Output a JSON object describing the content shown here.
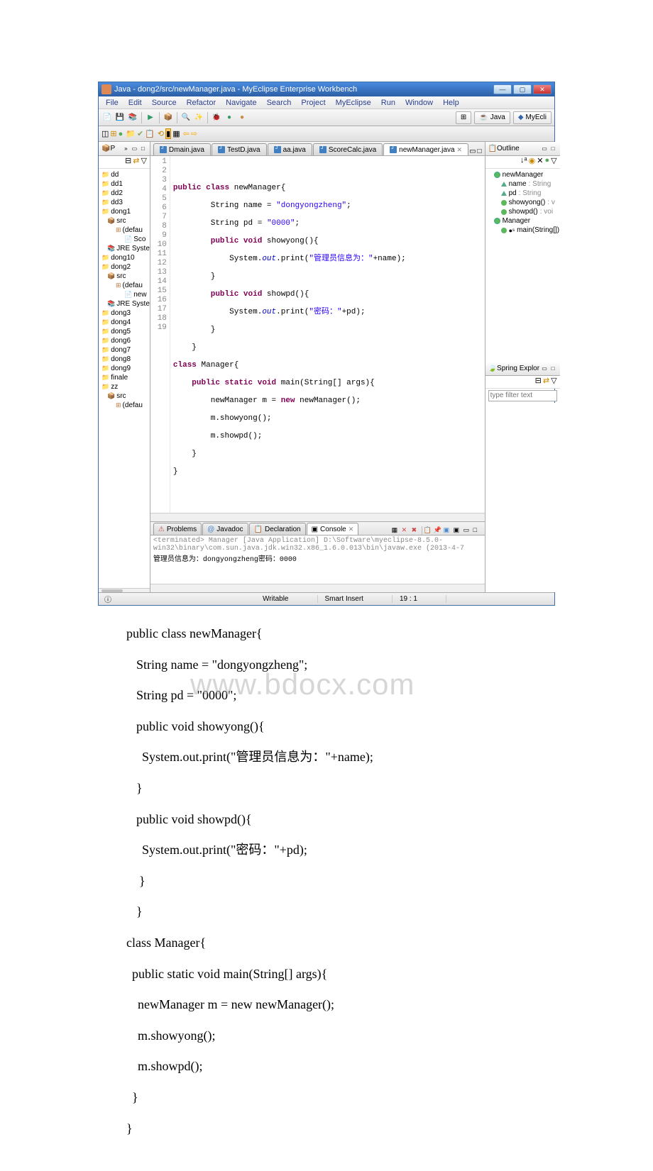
{
  "window": {
    "title": "Java - dong2/src/newManager.java - MyEclipse Enterprise Workbench",
    "min": "—",
    "max": "▢",
    "close": "✕"
  },
  "menu": {
    "items": [
      "File",
      "Edit",
      "Source",
      "Refactor",
      "Navigate",
      "Search",
      "Project",
      "MyEclipse",
      "Run",
      "Window",
      "Help"
    ]
  },
  "perspectives": {
    "java": "Java",
    "myecli": "MyEcli"
  },
  "package_explorer": {
    "tab": "P",
    "projects": [
      "dd",
      "dd1",
      "dd2",
      "dd3",
      "dong1",
      "dong10",
      "dong2",
      "dong3",
      "dong4",
      "dong5",
      "dong6",
      "dong7",
      "dong8",
      "dong9",
      "finale",
      "zz"
    ],
    "dong1_children": {
      "src": "src",
      "defau": "(defau",
      "sco": "Sco",
      "jre": "JRE Syste"
    },
    "dong2_children": {
      "src": "src",
      "defau": "(defau",
      "new": "new",
      "jre": "JRE Syste"
    },
    "zz_children": {
      "src": "src",
      "defau": "(defau"
    }
  },
  "editor": {
    "tabs": [
      "Dmain.java",
      "TestD.java",
      "aa.java",
      "ScoreCalc.java",
      "newManager.java"
    ],
    "active_tab": "newManager.java",
    "lines": {
      "l1": "",
      "l2a": "public class",
      "l2b": " newManager{",
      "l3a": "        String name = ",
      "l3b": "\"dongyongzheng\"",
      "l3c": ";",
      "l4a": "        String pd = ",
      "l4b": "\"0000\"",
      "l4c": ";",
      "l5a": "        public void",
      "l5b": " showyong(){",
      "l6a": "            System.",
      "l6b": "out",
      "l6c": ".print(",
      "l6d": "\"管理员信息为：\"",
      "l6e": "+name);",
      "l7": "        }",
      "l8a": "        public void",
      "l8b": " showpd(){",
      "l9a": "            System.",
      "l9b": "out",
      "l9c": ".print(",
      "l9d": "\"密码：\"",
      "l9e": "+pd);",
      "l10": "        }",
      "l11": "    }",
      "l12a": "class",
      "l12b": " Manager{",
      "l13a": "    public static void",
      "l13b": " main(String[] args){",
      "l14a": "        newManager m = ",
      "l14b": "new",
      "l14c": " newManager();",
      "l15": "        m.showyong();",
      "l16": "        m.showpd();",
      "l17": "    }",
      "l18": "}",
      "l19": ""
    }
  },
  "bottom": {
    "tabs": {
      "problems": "Problems",
      "javadoc": "Javadoc",
      "declaration": "Declaration",
      "console": "Console"
    },
    "terminated": "<terminated> Manager [Java Application] D:\\Software\\myeclipse-8.5.0-win32\\binary\\com.sun.java.jdk.win32.x86_1.6.0.013\\bin\\javaw.exe (2013-4-7",
    "output": "管理员信息为：dongyongzheng密码：0000"
  },
  "outline": {
    "tab": "Outline",
    "items": {
      "newManager": "newManager",
      "name": "name",
      "name_t": ": String",
      "pd": "pd",
      "pd_t": ": String",
      "showyong": "showyong()",
      "showyong_t": ": v",
      "showpd": "showpd()",
      "showpd_t": ": voi",
      "Manager": "Manager",
      "main": "main(String[])",
      "main_t": ": "
    }
  },
  "spring": {
    "tab": "Spring Explor",
    "filter": "type filter text"
  },
  "status": {
    "writable": "Writable",
    "smart": "Smart Insert",
    "pos": "19 : 1"
  },
  "below": {
    "l1": "public class newManager{",
    "l2": "String name = \"dongyongzheng\";",
    "l3": "String pd = \"0000\";",
    "l4": "public void showyong(){",
    "l5": "System.out.print(\"管理员信息为：\"+name);",
    "l6": "}",
    "l7": "public void showpd(){",
    "l8": "System.out.print(\"密码：\"+pd);",
    "l9": "}",
    "l10": "}",
    "l11": "class Manager{",
    "l12": "public static void main(String[] args){",
    "l13": "newManager m = new newManager();",
    "l14": "m.showyong();",
    "l15": "m.showpd();",
    "l16": "}",
    "l17": "}"
  },
  "watermark": "www.bdocx.com"
}
